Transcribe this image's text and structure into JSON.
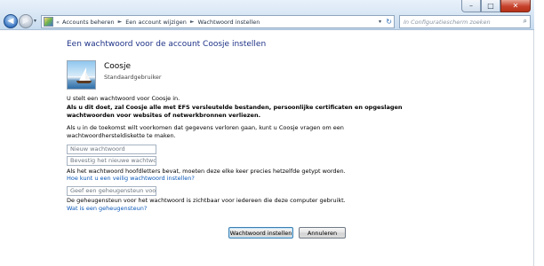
{
  "window_controls": {
    "minimize": "–",
    "maximize": "□",
    "close": "✕"
  },
  "nav": {
    "back": "◀",
    "forward": "▶",
    "dropdown": "▾"
  },
  "breadcrumb": {
    "overflow": "«",
    "separator": "►",
    "items": [
      "Accounts beheren",
      "Een account wijzigen",
      "Wachtwoord instellen"
    ]
  },
  "address_controls": {
    "dropdown": "▾",
    "refresh": "↻"
  },
  "search": {
    "placeholder": "In Configuratiescherm zoeken",
    "icon": "search-icon"
  },
  "page_title": "Een wachtwoord voor de account Coosje instellen",
  "user": {
    "name": "Coosje",
    "role": "Standaardgebruiker"
  },
  "intro": "U stelt een wachtwoord voor Coosje in.",
  "warning": [
    "Als u dit doet, zal Coosje alle met EFS versleutelde bestanden, persoonlijke certificaten en opgeslagen",
    "wachtwoorden voor websites of netwerkbronnen verliezen."
  ],
  "tip": [
    "Als u in de toekomst wilt voorkomen dat gegevens verloren gaan, kunt u Coosje vragen om een",
    "wachtwoordhersteldiskette te maken."
  ],
  "fields": {
    "new_password": "Nieuw wachtwoord",
    "confirm_password": "Bevestig het nieuwe wachtwoord",
    "hint": "Geef een geheugensteun voor het"
  },
  "case_note": "Als het wachtwoord hoofdletters bevat, moeten deze elke keer precies hetzelfde getypt worden.",
  "links": {
    "secure_password": "Hoe kunt u een veilig wachtwoord instellen?",
    "what_is_hint": "Wat is een geheugensteun?"
  },
  "hint_note": "De geheugensteun voor het wachtwoord is zichtbaar voor iedereen die deze computer gebruikt.",
  "buttons": {
    "submit": "Wachtwoord instellen",
    "cancel": "Annuleren"
  }
}
